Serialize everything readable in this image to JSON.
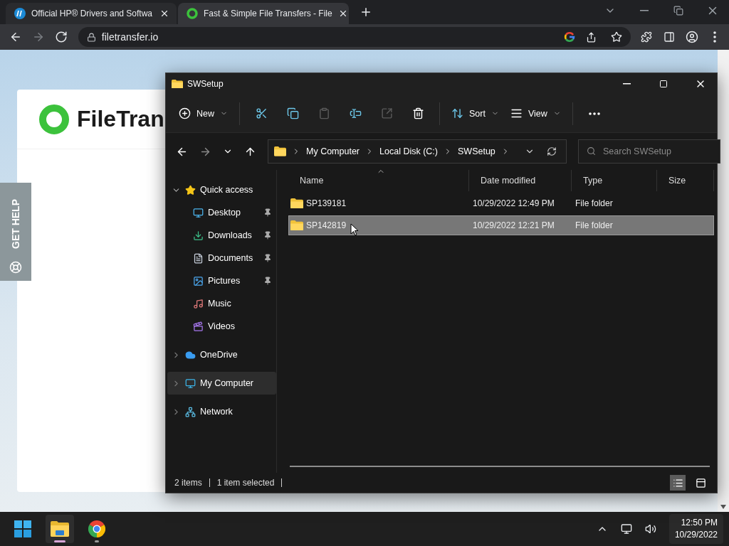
{
  "browser": {
    "tabs": [
      {
        "title": "Official HP® Drivers and Softwa",
        "kind": "hp",
        "selected": false
      },
      {
        "title": "Fast & Simple File Transfers - File",
        "kind": "ft",
        "selected": true
      }
    ],
    "nav": [
      {
        "kind": "back",
        "disabled": false
      },
      {
        "kind": "forward",
        "disabled": true
      },
      {
        "kind": "reload",
        "disabled": false
      }
    ],
    "address": "filetransfer.io"
  },
  "page": {
    "logo_text": "FileTran",
    "help_tab": "GET HELP"
  },
  "explorer": {
    "title": "SWSetup",
    "toolbar_groups": [
      {
        "commands": [
          {
            "kind": "new",
            "label": "New",
            "disabled": false
          }
        ]
      },
      {
        "commands": [
          {
            "kind": "cut",
            "disabled": false
          },
          {
            "kind": "copy",
            "disabled": false
          },
          {
            "kind": "paste",
            "disabled": true
          },
          {
            "kind": "rename",
            "disabled": false
          },
          {
            "kind": "share",
            "disabled": true
          },
          {
            "kind": "delete",
            "disabled": false
          }
        ]
      },
      {
        "commands": [
          {
            "kind": "sort",
            "label": "Sort",
            "disabled": false
          },
          {
            "kind": "view",
            "label": "View",
            "disabled": false
          }
        ]
      },
      {
        "commands": [
          {
            "kind": "more",
            "disabled": false
          }
        ]
      }
    ],
    "nav_buttons": [
      {
        "kind": "back",
        "disabled": false
      },
      {
        "kind": "forward",
        "disabled": true
      },
      {
        "kind": "recent",
        "disabled": false
      },
      {
        "kind": "up",
        "disabled": false
      }
    ],
    "breadcrumbs": [
      "My Computer",
      "Local Disk (C:)",
      "SWSetup"
    ],
    "search": {
      "placeholder": "Search SWSetup"
    },
    "nav_pane": [
      {
        "kind": "star",
        "label": "Quick access",
        "expanded": true,
        "selected": false,
        "children": [
          {
            "kind": "desktop",
            "label": "Desktop",
            "pinned": true
          },
          {
            "kind": "downloads",
            "label": "Downloads",
            "pinned": true
          },
          {
            "kind": "documents",
            "label": "Documents",
            "pinned": true
          },
          {
            "kind": "pictures",
            "label": "Pictures",
            "pinned": true
          },
          {
            "kind": "music",
            "label": "Music",
            "pinned": false
          },
          {
            "kind": "videos",
            "label": "Videos",
            "pinned": false
          }
        ]
      },
      {
        "kind": "onedrive",
        "label": "OneDrive",
        "expanded": false,
        "selected": false
      },
      {
        "kind": "computer",
        "label": "My Computer",
        "expanded": false,
        "selected": true
      },
      {
        "kind": "network",
        "label": "Network",
        "expanded": false,
        "selected": false
      }
    ],
    "columns": [
      {
        "label": "Name",
        "sorted": true
      },
      {
        "label": "Date modified",
        "sorted": false
      },
      {
        "label": "Type",
        "sorted": false
      },
      {
        "label": "Size",
        "sorted": false
      }
    ],
    "rows": [
      {
        "name": "SP139181",
        "date": "10/29/2022 12:49 PM",
        "type": "File folder",
        "selected": false
      },
      {
        "name": "SP142819",
        "date": "10/29/2022 12:21 PM",
        "type": "File folder",
        "selected": true
      }
    ],
    "status": {
      "items": "2 items",
      "selection": "1 item selected"
    },
    "view_modes": [
      {
        "kind": "details",
        "selected": true
      },
      {
        "kind": "tiles",
        "selected": false
      }
    ]
  },
  "taskbar": {
    "apps": [
      {
        "kind": "start",
        "active": false
      },
      {
        "kind": "explorer",
        "active": true
      },
      {
        "kind": "chrome",
        "active": false
      }
    ],
    "time": "12:50 PM",
    "date": "10/29/2022"
  }
}
